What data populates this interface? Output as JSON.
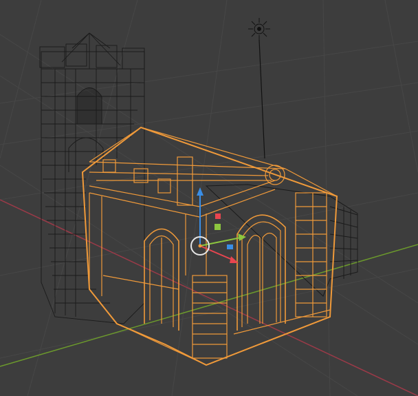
{
  "app": "3D viewport",
  "view_mode": "wireframe",
  "colors": {
    "background": "#3d3d3d",
    "grid": "#4a4a4a",
    "x_axis": "#9b3a48",
    "y_axis": "#6c9a2c",
    "wire_default": "#1a1a1a",
    "wire_selected": "#f09a3a",
    "gizmo_x": "#e8454f",
    "gizmo_y": "#8dc63f",
    "gizmo_z": "#3a8ee6",
    "origin_ring": "#e6e6e6"
  },
  "objects": [
    {
      "name": "bell-tower",
      "selected": false
    },
    {
      "name": "chapel-hall",
      "selected": true
    },
    {
      "name": "rear-annex",
      "selected": false
    },
    {
      "name": "sun-lamp",
      "selected": false
    }
  ],
  "icons": [
    "sun-lamp-icon",
    "transform-gizmo-icon",
    "origin-point-icon"
  ]
}
